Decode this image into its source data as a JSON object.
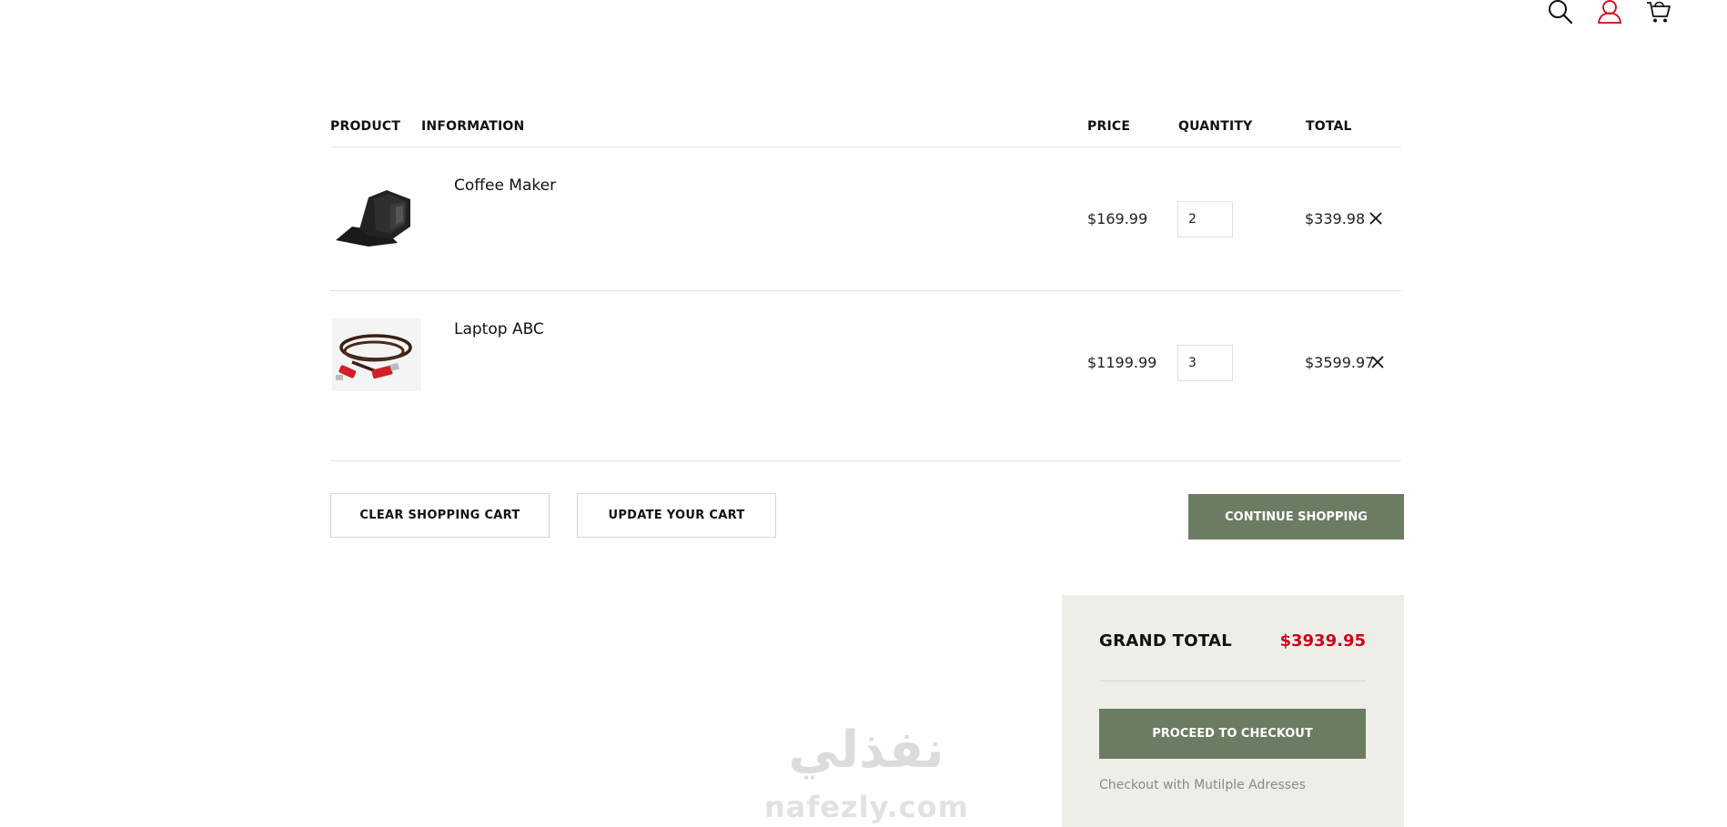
{
  "header": {
    "icons": [
      "search-icon",
      "user-icon",
      "cart-icon"
    ],
    "user_icon_color": "#d0021b"
  },
  "table": {
    "headers": {
      "product": "PRODUCT",
      "information": "INFORMATION",
      "price": "PRICE",
      "quantity": "QUANTITY",
      "total": "TOTAL"
    },
    "rows": [
      {
        "name": "Coffee Maker",
        "price": "$169.99",
        "quantity": "2",
        "total": "$339.98",
        "image": "phone-holder-thumbnail"
      },
      {
        "name": "Laptop ABC",
        "price": "$1199.99",
        "quantity": "3",
        "total": "$3599.97",
        "image": "hdmi-cable-thumbnail"
      }
    ]
  },
  "actions": {
    "clear": "CLEAR SHOPPING CART",
    "update": "UPDATE YOUR CART",
    "continue": "CONTINUE SHOPPING"
  },
  "summary": {
    "grand_total_label": "GRAND TOTAL",
    "grand_total_value": "$3939.95",
    "checkout": "PROCEED TO CHECKOUT",
    "multi_address": "Checkout with Mutilple Adresses"
  },
  "watermark": {
    "arabic": "نفذلي",
    "latin": "nafezly.com"
  },
  "colors": {
    "accent_button": "#6b7c62",
    "total_red": "#d0021b",
    "panel_bg": "#eeeee9"
  }
}
